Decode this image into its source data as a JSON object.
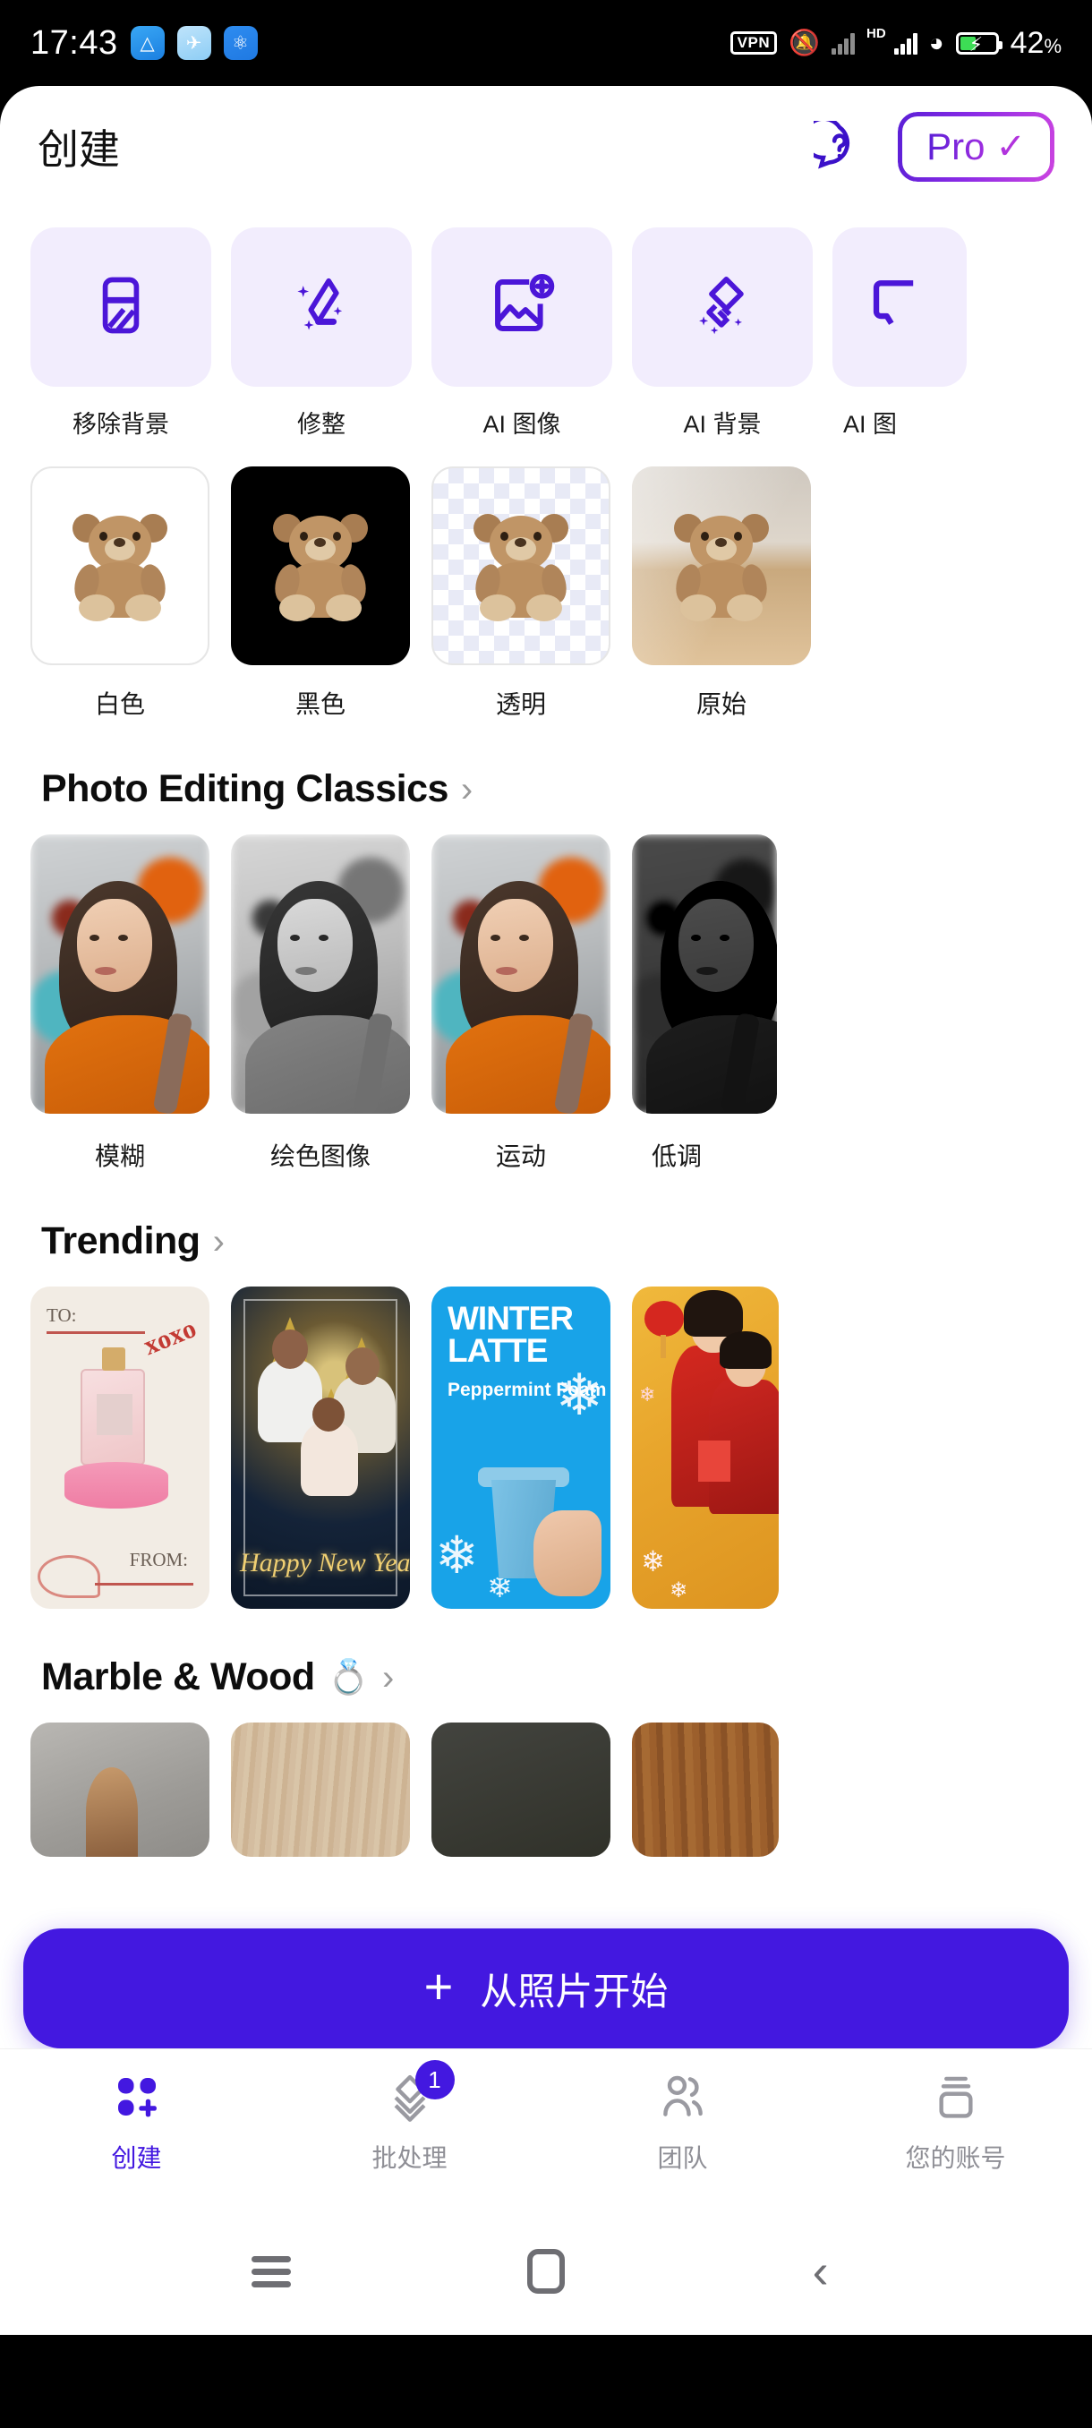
{
  "status_bar": {
    "time": "17:43",
    "app_icons": [
      "appstore-icon",
      "bird-icon",
      "cloud-icon"
    ],
    "vpn_label": "VPN",
    "mute_icon": "bell-muted-icon",
    "signal_hd_label": "HD",
    "wifi_icon": "wifi-icon",
    "battery_percent": "42",
    "battery_percent_symbol": "%"
  },
  "header": {
    "title": "创建",
    "help_icon": "help-question-icon",
    "pro_label": "Pro",
    "pro_check": "✓"
  },
  "tools": [
    {
      "label": "移除背景",
      "icon": "eraser-icon"
    },
    {
      "label": "修整",
      "icon": "retouch-sparkle-icon"
    },
    {
      "label": "AI 图像",
      "icon": "image-plus-icon"
    },
    {
      "label": "AI 背景",
      "icon": "layers-sparkle-icon"
    },
    {
      "label": "AI 图",
      "icon": "frame-icon"
    }
  ],
  "background_options": [
    {
      "label": "白色",
      "variant": "white"
    },
    {
      "label": "黑色",
      "variant": "black"
    },
    {
      "label": "透明",
      "variant": "transparent"
    },
    {
      "label": "原始",
      "variant": "original"
    }
  ],
  "sections": {
    "classics": {
      "title": "Photo Editing Classics",
      "chevron": "›",
      "items": [
        {
          "label": "模糊",
          "style": "color"
        },
        {
          "label": "绘色图像",
          "style": "gray"
        },
        {
          "label": "运动",
          "style": "color"
        },
        {
          "label": "低调",
          "style": "lowkey"
        }
      ]
    },
    "trending": {
      "title": "Trending",
      "chevron": "›",
      "cards": [
        {
          "name": "valentine-card",
          "to": "TO:",
          "xoxo": "xoxo",
          "from": "FROM:"
        },
        {
          "name": "new-year-card",
          "greeting": "Happy New Year"
        },
        {
          "name": "winter-latte-card",
          "title": "WINTER\nLATTE",
          "subtitle": "Peppermint Foam"
        },
        {
          "name": "chinese-new-year-card"
        }
      ]
    },
    "marble_wood": {
      "title": "Marble & Wood",
      "emoji": "💍",
      "chevron": "›"
    }
  },
  "cta": {
    "plus": "+",
    "label": "从照片开始"
  },
  "bottom_nav": [
    {
      "label": "创建",
      "icon": "grid-plus-icon",
      "active": true,
      "badge": null
    },
    {
      "label": "批处理",
      "icon": "layers-icon",
      "active": false,
      "badge": "1"
    },
    {
      "label": "团队",
      "icon": "people-icon",
      "active": false,
      "badge": null
    },
    {
      "label": "您的账号",
      "icon": "account-card-icon",
      "active": false,
      "badge": null
    }
  ],
  "android_nav": {
    "recents": "recents-icon",
    "home": "home-icon",
    "back": "‹"
  },
  "colors": {
    "accent": "#4318e0",
    "tool_card_bg": "#f2edfd",
    "pro_gradient_start": "#5a1fd6",
    "pro_gradient_end": "#cc44e0",
    "inactive_nav": "#8f8f96"
  }
}
